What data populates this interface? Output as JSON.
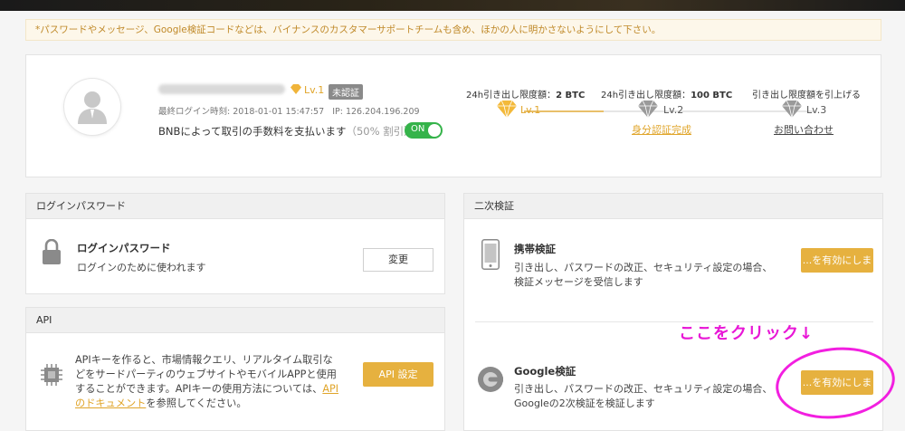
{
  "notice": "*パスワードやメッセージ、Google検証コードなどは、バイナンスのカスタマーサポートチームも含め、ほかの人に明かさないようにして下さい。",
  "profile": {
    "level": "Lv.1",
    "badge": "未認証",
    "last_login_label": "最終ログイン時刻:",
    "last_login_time": "2018-01-01 15:47:57",
    "ip_label": "IP:",
    "ip": "126.204.196.209",
    "bnb_text": "BNBによって取引の手数料を支払います",
    "bnb_discount": "（50% 割引）",
    "toggle_label": "ON"
  },
  "limits": {
    "lv1_header_prefix": "24h引き出し限度額：",
    "lv1_amount": "2 BTC",
    "lv2_header_prefix": "24h引き出し限度額：",
    "lv2_amount": "100 BTC",
    "lv3_header": "引き出し限度額を引上げる",
    "lv1_label": "Lv.1",
    "lv2_label": "Lv.2",
    "lv3_label": "Lv.3",
    "lv2_link": "身分認証完成",
    "lv3_link": "お問い合わせ"
  },
  "login_panel": {
    "header": "ログインパスワード",
    "title": "ログインパスワード",
    "desc": "ログインのために使われます",
    "button": "変更"
  },
  "api_panel": {
    "header": "API",
    "desc_1": "APIキーを作ると、市場情報クエリ、リアルタイム取引な",
    "desc_2": "どをサードパーティのウェブサイトやモバイルAPPと使用",
    "desc_3": "することができます。APIキーの使用方法については、",
    "link_1": "API",
    "link_2": "のドキュメント",
    "desc_4": "を参照してください。",
    "button": "API 設定"
  },
  "twofa_panel": {
    "header": "二次検証",
    "sms_title": "携帯検証",
    "sms_desc_1": "引き出し、パスワードの改正、セキュリティ設定の場合、",
    "sms_desc_2": "検証メッセージを受信します",
    "sms_button": "...を有効にしま",
    "google_title": "Google検証",
    "google_desc_1": "引き出し、パスワードの改正、セキュリティ設定の場合、",
    "google_desc_2": "Googleの2次検証を検証します",
    "google_button": "...を有効にしま"
  },
  "annotation": {
    "text": "ここをクリック↓",
    "color": "#e817d6"
  },
  "colors": {
    "gold": "#e6b13f",
    "green": "#35b34a",
    "accent_text": "#e0a52a"
  }
}
